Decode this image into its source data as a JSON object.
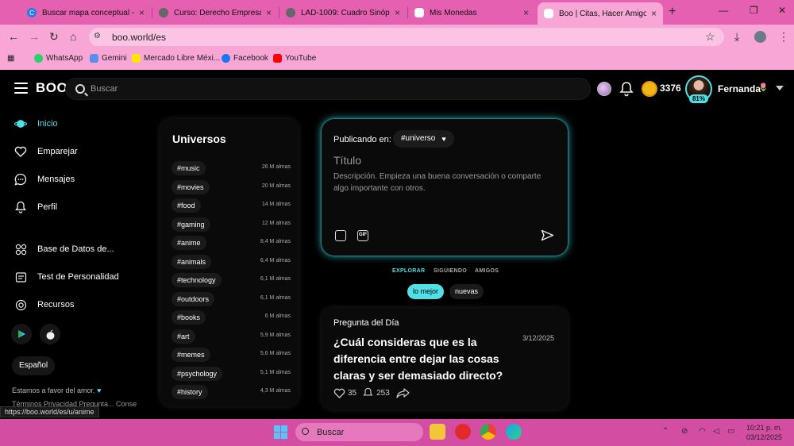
{
  "browser": {
    "tabs": [
      {
        "title": "Buscar mapa conceptual - C",
        "icon": "edge-search-icon",
        "color": "#2a7de1"
      },
      {
        "title": "Curso: Derecho Empresarial",
        "icon": "globe-icon",
        "color": "#666666"
      },
      {
        "title": "LAD-1009: Cuadro Sinóptico",
        "icon": "globe-icon",
        "color": "#666666"
      },
      {
        "title": "Mis Monedas",
        "icon": "boo-icon",
        "color": "#ffffff"
      },
      {
        "title": "Boo | Citas, Hacer Amigos, C",
        "icon": "boo-icon",
        "color": "#ffffff"
      }
    ],
    "url": "boo.world/es",
    "bookmarks": [
      {
        "label": "WhatsApp",
        "color": "#25d366"
      },
      {
        "label": "Gemini",
        "color": "#5b8def"
      },
      {
        "label": "Mercado Libre Méxi...",
        "color": "#ffe600"
      },
      {
        "label": "Facebook",
        "color": "#1877f2"
      },
      {
        "label": "YouTube",
        "color": "#ff0000"
      }
    ],
    "status_url": "https://boo.world/es/u/anime"
  },
  "header": {
    "logo": "BOO",
    "search_placeholder": "Buscar",
    "coins": "3376",
    "user_name": "Fernanda",
    "user_emoji": "🌷",
    "profile_percent": "81%"
  },
  "sidebar": {
    "items": [
      {
        "label": "Inicio",
        "icon": "planet-icon",
        "active": true
      },
      {
        "label": "Emparejar",
        "icon": "heart-icon"
      },
      {
        "label": "Mensajes",
        "icon": "chat-icon"
      },
      {
        "label": "Perfil",
        "icon": "bell-icon"
      },
      {
        "label": "Base de Datos de...",
        "icon": "database-icon"
      },
      {
        "label": "Test de Personalidad",
        "icon": "test-icon"
      },
      {
        "label": "Recursos",
        "icon": "resources-icon"
      }
    ],
    "language": "Español",
    "love_text": "Estamos a favor del amor.",
    "footer_links": "Términos    Privacidad    Pregunta...    Conse"
  },
  "universes": {
    "title": "Universos",
    "items": [
      {
        "tag": "#music",
        "count": "26 M almas"
      },
      {
        "tag": "#movies",
        "count": "20 M almas"
      },
      {
        "tag": "#food",
        "count": "14 M almas"
      },
      {
        "tag": "#gaming",
        "count": "12 M almas"
      },
      {
        "tag": "#anime",
        "count": "8,4 M almas"
      },
      {
        "tag": "#animals",
        "count": "6,4 M almas"
      },
      {
        "tag": "#technology",
        "count": "6,1 M almas"
      },
      {
        "tag": "#outdoors",
        "count": "6,1 M almas"
      },
      {
        "tag": "#books",
        "count": "6 M almas"
      },
      {
        "tag": "#art",
        "count": "5,9 M almas"
      },
      {
        "tag": "#memes",
        "count": "5,6 M almas"
      },
      {
        "tag": "#psychology",
        "count": "5,1 M almas"
      },
      {
        "tag": "#history",
        "count": "4,3 M almas"
      }
    ]
  },
  "composer": {
    "publishing_in": "Publicando en:",
    "universe_picker": "#universo",
    "title_placeholder": "Título",
    "desc_placeholder": "Descripción. Empieza una buena conversación o comparte algo importante con otros."
  },
  "feed_tabs": [
    "EXPLORAR",
    "SIGUIENDO",
    "AMIGOS"
  ],
  "sort": {
    "best": "lo mejor",
    "new": "nuevas"
  },
  "question": {
    "label": "Pregunta del Día",
    "date": "3/12/2025",
    "text": "¿Cuál consideras que es la diferencia entre dejar las cosas claras y ser demasiado directo?",
    "likes": "35",
    "comments": "253"
  },
  "taskbar": {
    "search": "Buscar",
    "time": "10:21 p. m.",
    "date": "03/12/2025"
  },
  "colors": {
    "accent": "#51e0e6",
    "tabbar": "#e560b0",
    "taskbar": "#d34ea3"
  }
}
